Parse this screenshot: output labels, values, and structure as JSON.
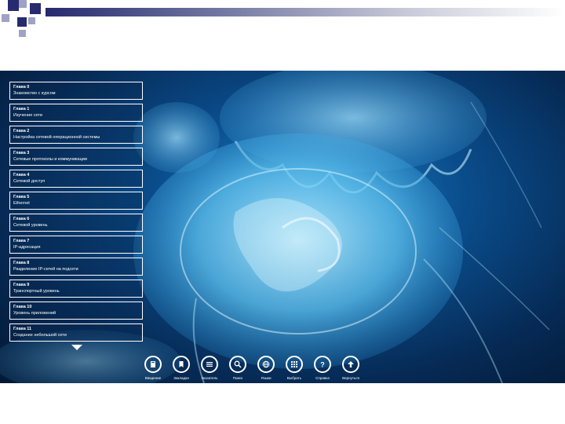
{
  "chapters": [
    {
      "title": "Глава 0",
      "subtitle": "Знакомство с курсом"
    },
    {
      "title": "Глава 1",
      "subtitle": "Изучение сети"
    },
    {
      "title": "Глава 2",
      "subtitle": "Настройка сетевой операционной системы"
    },
    {
      "title": "Глава 3",
      "subtitle": "Сетевые протоколы и коммуникации"
    },
    {
      "title": "Глава 4",
      "subtitle": "Сетевой доступ"
    },
    {
      "title": "Глава 5",
      "subtitle": "Ethernet"
    },
    {
      "title": "Глава 6",
      "subtitle": "Сетевой уровень"
    },
    {
      "title": "Глава 7",
      "subtitle": "IP-адресация"
    },
    {
      "title": "Глава 8",
      "subtitle": "Разделение IP-сетей на подсети"
    },
    {
      "title": "Глава 9",
      "subtitle": "Транспортный уровень"
    },
    {
      "title": "Глава 10",
      "subtitle": "Уровень приложений"
    },
    {
      "title": "Глава 11",
      "subtitle": "Создание небольшой сети"
    }
  ],
  "toolbar": [
    {
      "label": "Введение",
      "icon": "book-icon"
    },
    {
      "label": "Закладки",
      "icon": "bookmark-icon"
    },
    {
      "label": "Указатель",
      "icon": "list-icon"
    },
    {
      "label": "Поиск",
      "icon": "search-icon"
    },
    {
      "label": "Языки",
      "icon": "globe-icon"
    },
    {
      "label": "Выбрать",
      "icon": "grid-icon"
    },
    {
      "label": "Справка",
      "icon": "help-icon"
    },
    {
      "label": "Вернуться",
      "icon": "arrow-up-icon"
    }
  ],
  "colors": {
    "deco_dark": "#262a6e",
    "deco_light": "#9ea2c4",
    "screen_bg": "#0a4d8c",
    "jelly": "#7fd4f5"
  }
}
